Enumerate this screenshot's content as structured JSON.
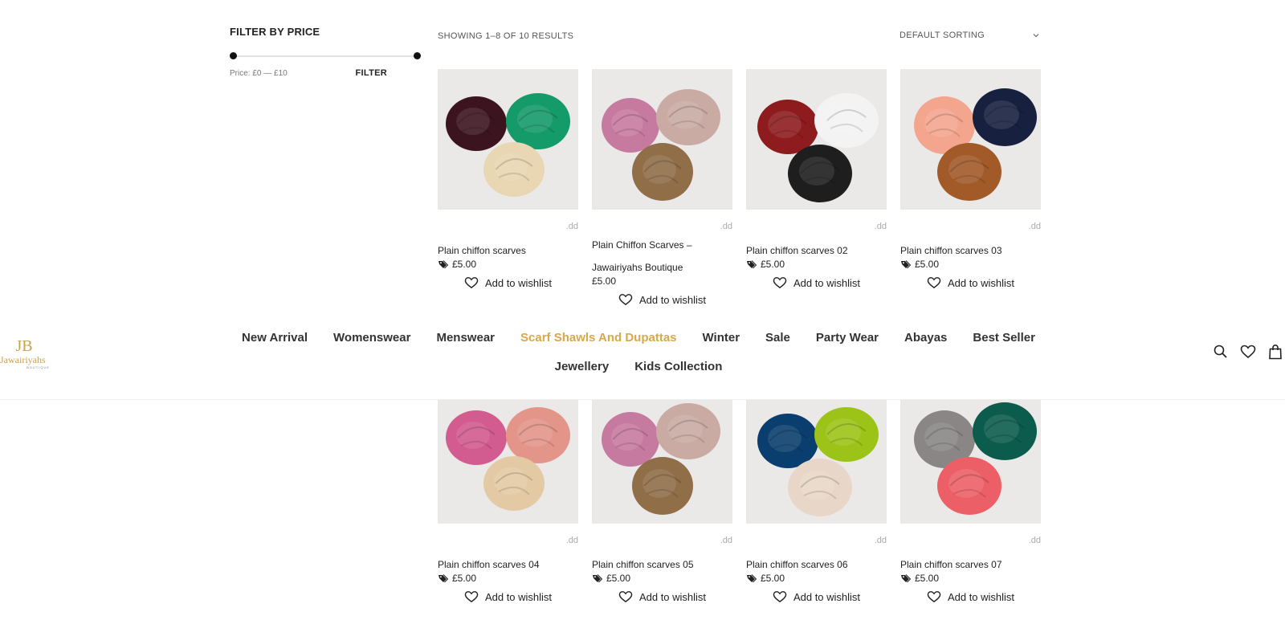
{
  "filter": {
    "title": "FILTER BY PRICE",
    "price_label": "Price: £0 — £10",
    "price_min": 0,
    "price_max": 10,
    "button_label": "FILTER"
  },
  "results": {
    "count_text": "SHOWING 1–8 OF 10 RESULTS",
    "sorting_selected": "DEFAULT SORTING"
  },
  "products": [
    {
      "name": "Plain chiffon scarves",
      "price": "£5.00",
      "badge": ".dd",
      "wishlist": "Add to wishlist",
      "colors": [
        "#3b1420",
        "#159a6a",
        "#e9d6b3"
      ]
    },
    {
      "name": "Plain Chiffon Scarves – Jawairiyahs Boutique",
      "price": "£5.00",
      "badge": ".dd",
      "wishlist": "Add to wishlist",
      "colors": [
        "#c77aa0",
        "#c9aba4",
        "#8f6e48"
      ]
    },
    {
      "name": "Plain chiffon scarves 02",
      "price": "£5.00",
      "badge": ".dd",
      "wishlist": "Add to wishlist",
      "colors": [
        "#8e1b1d",
        "#f3f3f3",
        "#1e1e1e"
      ]
    },
    {
      "name": "Plain chiffon scarves 03",
      "price": "£5.00",
      "badge": ".dd",
      "wishlist": "Add to wishlist",
      "colors": [
        "#f4a58e",
        "#17203e",
        "#a25a28"
      ]
    },
    {
      "name": "Plain chiffon scarves 04",
      "price": "£5.00",
      "badge": ".dd",
      "wishlist": "Add to wishlist",
      "colors": [
        "#d25b8f",
        "#e3958a",
        "#e4caa4"
      ]
    },
    {
      "name": "Plain chiffon scarves 05",
      "price": "£5.00",
      "badge": ".dd",
      "wishlist": "Add to wishlist",
      "colors": [
        "#c77aa0",
        "#c9aba4",
        "#8f6e48"
      ]
    },
    {
      "name": "Plain chiffon scarves 06",
      "price": "£5.00",
      "badge": ".dd",
      "wishlist": "Add to wishlist",
      "colors": [
        "#0a3e6e",
        "#9cc317",
        "#e8d7c8"
      ]
    },
    {
      "name": "Plain chiffon scarves 07",
      "price": "£5.00",
      "badge": ".dd",
      "wishlist": "Add to wishlist",
      "colors": [
        "#8a8686",
        "#0b5c4c",
        "#ec5f66"
      ]
    }
  ],
  "header": {
    "logo_mark": "JB",
    "logo_name": "Jawairiyahs",
    "logo_sub": "BOUTIQUE",
    "nav_row1": [
      "New Arrival",
      "Womenswear",
      "Menswear",
      "Scarf Shawls And Dupattas",
      "Winter",
      "Sale",
      "Party Wear",
      "Abayas",
      "Best Seller"
    ],
    "nav_row2": [
      "Jewellery",
      "Kids Collection"
    ],
    "active_item": "Scarf Shawls And Dupattas",
    "icons": [
      "search-icon",
      "heart-icon",
      "shopping-bag-icon"
    ]
  },
  "colors": {
    "accent": "#d9a84a",
    "logo_gold": "#c9a24b",
    "text": "#222222"
  }
}
